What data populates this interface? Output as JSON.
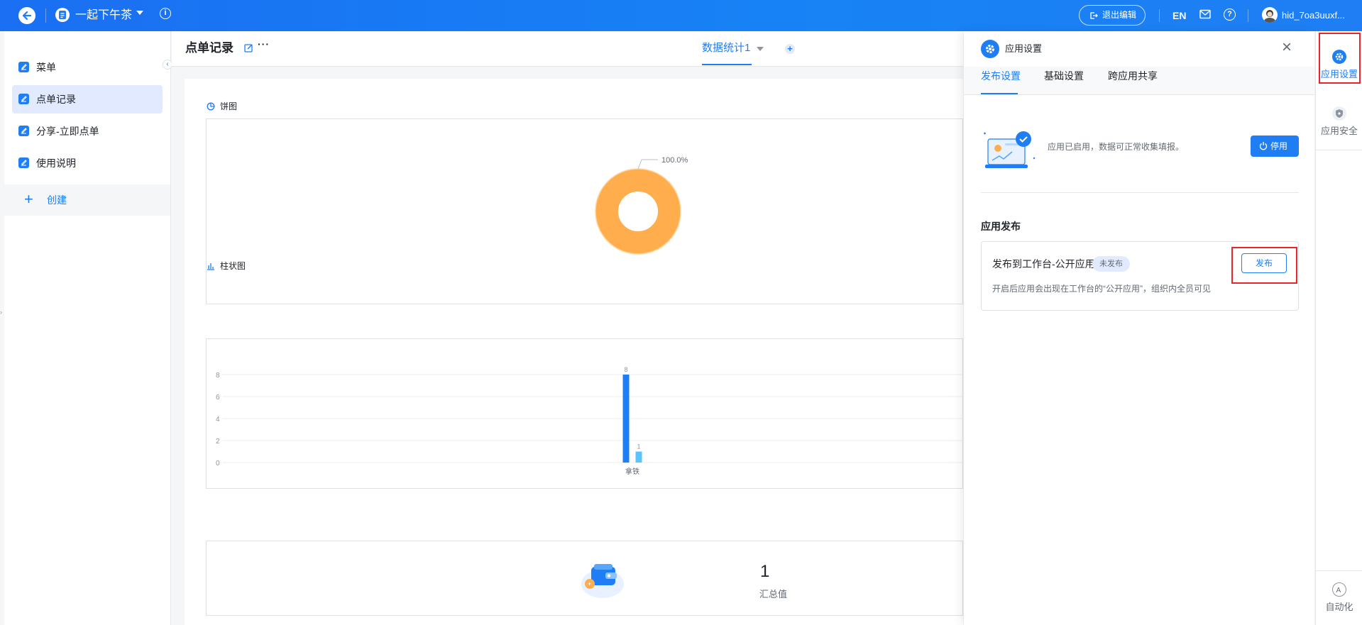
{
  "topbar": {
    "app_name": "一起下午茶",
    "exit_edit": "退出编辑",
    "lang": "EN",
    "user": "hid_7oa3uuxf..."
  },
  "sidebar": {
    "items": [
      {
        "label": "菜单"
      },
      {
        "label": "点单记录"
      },
      {
        "label": "分享-立即点单"
      },
      {
        "label": "使用说明"
      }
    ],
    "create": "创建"
  },
  "main": {
    "title": "点单记录",
    "more": "···",
    "tab": "数据统计1"
  },
  "pie_card": {
    "title": "饼图",
    "label": "100.0%"
  },
  "bar_card": {
    "title": "柱状图",
    "bar_labels": [
      "8",
      "1"
    ],
    "category": "拿铁"
  },
  "summary_card": {
    "value": "1",
    "label": "汇总值"
  },
  "chart_data": [
    {
      "type": "pie",
      "title": "饼图",
      "slices": [
        {
          "value": 100.0
        }
      ],
      "colors": [
        "#ffad4d"
      ]
    },
    {
      "type": "bar",
      "title": "柱状图",
      "categories": [
        "拿铁"
      ],
      "series": [
        {
          "values": [
            8
          ]
        },
        {
          "values": [
            1
          ]
        }
      ],
      "yticks": [
        "0",
        "2",
        "4",
        "6",
        "8"
      ],
      "ylim": [
        0,
        8
      ],
      "colors": [
        "#1f7ef3",
        "#59c4ff"
      ]
    }
  ],
  "panel": {
    "title": "应用设置",
    "tabs": [
      "发布设置",
      "基础设置",
      "跨应用共享"
    ],
    "status_text": "应用已启用，数据可正常收集填报。",
    "stop_button": "停用",
    "section_title": "应用发布",
    "publish": {
      "name": "发布到工作台-公开应用",
      "badge": "未发布",
      "desc": "开启后应用会出现在工作台的“公开应用”，组织内全员可见",
      "button": "发布"
    }
  },
  "rail": {
    "items": [
      "应用设置",
      "应用安全"
    ],
    "automation": "自动化"
  },
  "colors": {
    "primary": "#1f7ef3",
    "accent_orange": "#ffad4d",
    "highlight_red": "#e8252b"
  }
}
